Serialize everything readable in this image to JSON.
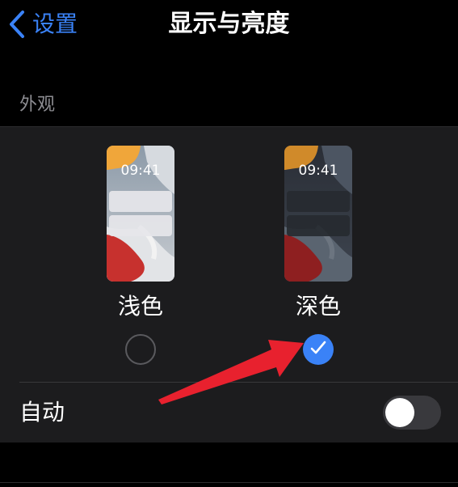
{
  "nav": {
    "back_label": "设置",
    "title": "显示与亮度"
  },
  "appearance": {
    "header": "外观",
    "options": [
      {
        "label": "浅色",
        "time": "09:41",
        "selected": false
      },
      {
        "label": "深色",
        "time": "09:41",
        "selected": true
      }
    ],
    "auto_label": "自动",
    "auto_enabled": false
  },
  "colors": {
    "accent": "#3a82f7",
    "background": "#000000",
    "group_background": "#1c1c1e",
    "annotation_arrow": "#e8212e"
  }
}
